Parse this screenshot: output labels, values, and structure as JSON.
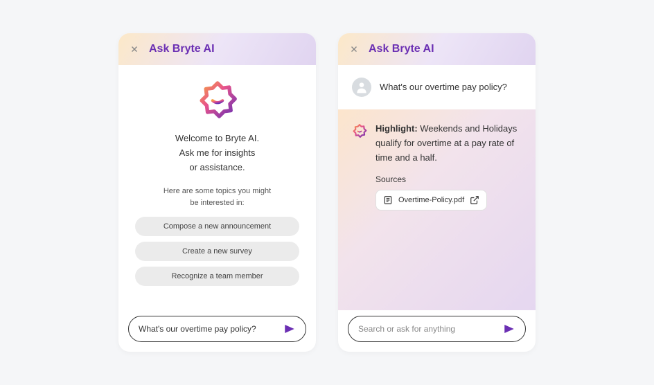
{
  "panelTitle": "Ask Bryte AI",
  "panel1": {
    "welcomeLine1": "Welcome to Bryte AI.",
    "welcomeLine2": "Ask me for insights",
    "welcomeLine3": "or assistance.",
    "topicsLine1": "Here are some topics you might",
    "topicsLine2": "be interested in:",
    "suggestions": [
      "Compose a new announcement",
      "Create a new survey",
      "Recognize a team member"
    ],
    "inputValue": "What's our overtime pay policy?"
  },
  "panel2": {
    "userMessage": "What's our overtime pay policy?",
    "highlightLabel": "Highlight:",
    "responseText": " Weekends and Holidays qualify for overtime at a pay rate of time and a half.",
    "sourcesLabel": "Sources",
    "sourceName": "Overtime-Policy.pdf",
    "inputPlaceholder": "Search or ask for anything"
  }
}
